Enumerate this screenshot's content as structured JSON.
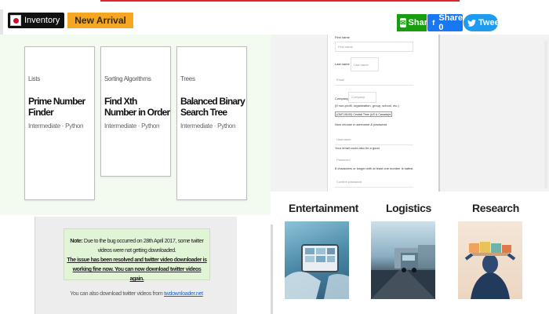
{
  "header": {
    "brand_label": "Inventory",
    "badge_label": "New Arrival",
    "share": {
      "whatsapp_label": "Share",
      "facebook_label": "Share 0",
      "twitter_label": "Tweet"
    }
  },
  "cards": [
    {
      "category": "Lists",
      "title": "Prime Number Finder",
      "meta": "Intermediate · Python"
    },
    {
      "category": "Sorting Algorithms",
      "title": "Find Xth Number in Order",
      "meta": "Intermediate · Python"
    },
    {
      "category": "Trees",
      "title": "Balanced Binary Search Tree",
      "meta": "Intermediate · Python"
    }
  ],
  "form": {
    "first_name_label": "First name",
    "first_name_placeholder": "First name",
    "last_name_label": "Last name",
    "last_name_value": "Last name",
    "email_placeholder": "Email",
    "company_label": "Company",
    "company_placeholder": "Company",
    "company_hint": "(If non-profit, organization, group, school, etc.)",
    "timezone_value": "(GMT-06:00) Central Time (US & Canada)",
    "section_label": "Now choose a username & password",
    "username_placeholder": "Username",
    "username_hint": "Your email could also be a good",
    "password_placeholder": "Password",
    "password_hint": "8 characters or longer with at least one number is safest.",
    "confirm_placeholder": "Confirm password"
  },
  "notice": {
    "note_prefix": "Note:",
    "note_text": "Due to the bug occurred on 28th April 2017, some twitter videos were not getting downloaded.",
    "resolved_text": "The issue has been resolved and twitter video downloader is working fine now. You can now download twitter videos again.",
    "also_text": "You can also download twitter videos from",
    "also_link": "twdownloader.net"
  },
  "categories": [
    {
      "title": "Entertainment"
    },
    {
      "title": "Logistics"
    },
    {
      "title": "Research"
    }
  ],
  "colors": {
    "top_line": "#e0262b",
    "badge": "#f5a623",
    "whatsapp": "#189d0e",
    "facebook": "#1877f2",
    "twitter": "#1d9bf0",
    "notice_bg": "#e2f4d6"
  }
}
